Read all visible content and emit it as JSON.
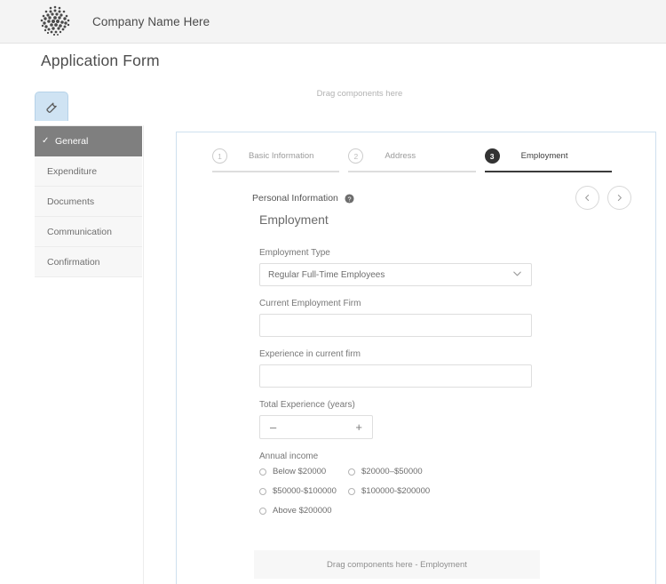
{
  "header": {
    "brand_name": "Company Name Here",
    "logo_icon": "halftone-dots-logo"
  },
  "page_title": "Application Form",
  "top_dropzone_text": "Drag components here",
  "tool_tab": {
    "icon": "wrench-icon"
  },
  "sidebar": {
    "items": [
      {
        "label": "General",
        "active": true,
        "check": "✓"
      },
      {
        "label": "Expenditure",
        "active": false
      },
      {
        "label": "Documents",
        "active": false
      },
      {
        "label": "Communication",
        "active": false
      },
      {
        "label": "Confirmation",
        "active": false
      }
    ]
  },
  "wizard": {
    "steps": [
      {
        "number": "1",
        "label": "Basic Information",
        "active": false
      },
      {
        "number": "2",
        "label": "Address",
        "active": false
      },
      {
        "number": "3",
        "label": "Employment",
        "active": true
      }
    ]
  },
  "section": {
    "eyebrow": "Personal Information",
    "info_icon": "info-circle-icon",
    "title": "Employment"
  },
  "nav": {
    "prev_icon": "chevron-left-icon",
    "next_icon": "chevron-right-icon"
  },
  "form": {
    "employment_type": {
      "label": "Employment Type",
      "value": "Regular Full-Time Employees",
      "chevron_icon": "chevron-down-icon"
    },
    "current_firm": {
      "label": "Current Employment Firm",
      "value": "",
      "placeholder": ""
    },
    "experience_current_firm": {
      "label": "Experience in current firm",
      "value": "",
      "placeholder": ""
    },
    "total_experience": {
      "label": "Total Experience (years)",
      "value": "",
      "decrement_label": "–",
      "increment_label": "+"
    },
    "annual_income": {
      "label": "Annual income",
      "options": [
        "Below $20000",
        "$20000–$50000",
        "$50000-$100000",
        "$100000-$200000",
        "Above $200000"
      ],
      "selected": null
    }
  },
  "bottom_dropzone_text": "Drag components here - Employment",
  "colors": {
    "topbar_bg": "#f4f4f4",
    "sidebar_active_bg": "#7f7f7f",
    "card_border": "#cfe0ef",
    "tool_tab_bg": "#cfe3f3",
    "step_active": "#333333"
  }
}
